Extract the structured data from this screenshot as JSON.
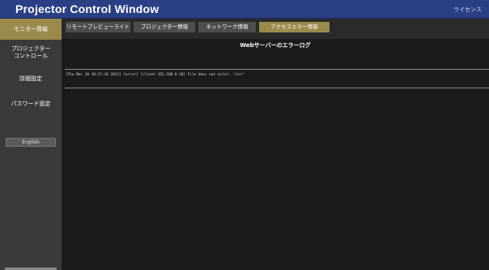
{
  "app": {
    "title": "Projector Control Window",
    "license_link": "ライセンス"
  },
  "sidebar": {
    "items": [
      {
        "label": "モニター情報",
        "active": true
      },
      {
        "label": "プロジェクター\nコントロール",
        "active": false
      },
      {
        "label": "詳細設定",
        "active": false
      },
      {
        "label": "パスワード設定",
        "active": false
      }
    ],
    "language_button": "English"
  },
  "tabs": [
    {
      "label": "リモートプレビューライト",
      "active": false
    },
    {
      "label": "プロジェクター情報",
      "active": false
    },
    {
      "label": "ネットワーク情報",
      "active": false
    },
    {
      "label": "アクセスエラー情報",
      "active": true
    }
  ],
  "main": {
    "section_title": "Webサーバーのエラーログ",
    "log_lines": [
      "[Thu Mar 10 10:27:16 2022] [error] [client 192.168.0.10] File does not exist: '/err'"
    ]
  },
  "colors": {
    "titlebar": "#2b3f85",
    "sidebar": "#3a3a3a",
    "accent": "#9a8a4c",
    "background": "#1b1b1b"
  }
}
